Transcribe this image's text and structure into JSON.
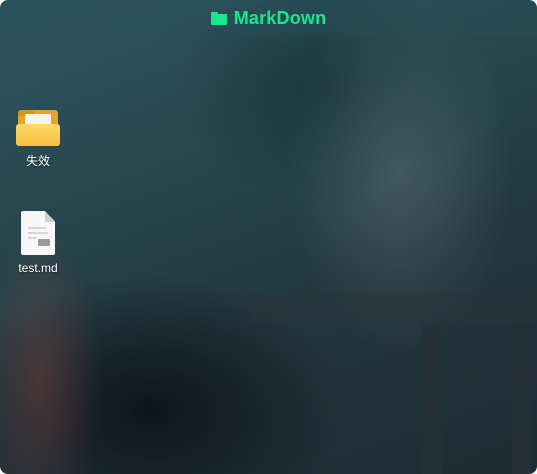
{
  "window": {
    "title": "MarkDown",
    "title_icon": "folder-icon",
    "accent_color": "#19e88a"
  },
  "desktop": {
    "items": [
      {
        "label": "失效",
        "type": "folder",
        "icon": "folder-icon"
      },
      {
        "label": "test.md",
        "type": "file",
        "icon": "markdown-file-icon"
      }
    ]
  }
}
